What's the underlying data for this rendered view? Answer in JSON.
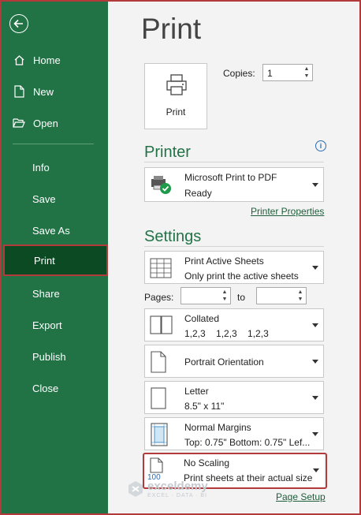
{
  "sidebar": {
    "items": [
      {
        "label": "Home",
        "icon": "home-icon"
      },
      {
        "label": "New",
        "icon": "new-document-icon"
      },
      {
        "label": "Open",
        "icon": "folder-open-icon"
      },
      {
        "label": "Info"
      },
      {
        "label": "Save"
      },
      {
        "label": "Save As"
      },
      {
        "label": "Print"
      },
      {
        "label": "Share"
      },
      {
        "label": "Export"
      },
      {
        "label": "Publish"
      },
      {
        "label": "Close"
      }
    ],
    "selected": "Print"
  },
  "main": {
    "title": "Print",
    "print_button_label": "Print",
    "copies_label": "Copies:",
    "copies_value": "1",
    "printer_section": "Printer",
    "printer": {
      "name": "Microsoft Print to PDF",
      "status": "Ready"
    },
    "printer_properties_link": "Printer Properties",
    "settings_section": "Settings",
    "settings": [
      {
        "line1": "Print Active Sheets",
        "line2": "Only print the active sheets"
      },
      {
        "line1": "Collated",
        "line2": "1,2,3    1,2,3    1,2,3"
      },
      {
        "line1": "Portrait Orientation",
        "line2": ""
      },
      {
        "line1": "Letter",
        "line2": "8.5\" x 11\""
      },
      {
        "line1": "Normal Margins",
        "line2": "Top: 0.75\" Bottom: 0.75\" Lef..."
      },
      {
        "line1": "No Scaling",
        "line2": "Print sheets at their actual size"
      }
    ],
    "pages_label": "Pages:",
    "to_label": "to",
    "page_setup_link": "Page Setup",
    "scaling_icon_text": "100"
  },
  "watermark": {
    "name": "exceldemy",
    "tagline": "EXCEL · DATA · BI"
  },
  "colors": {
    "accent": "#217346",
    "selected": "#0b4a23",
    "highlight": "#b23a3a"
  }
}
